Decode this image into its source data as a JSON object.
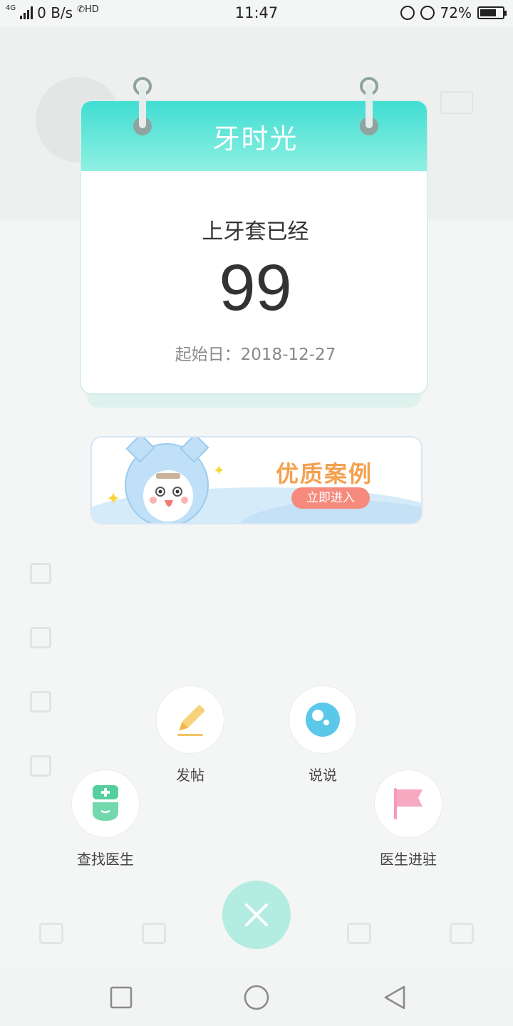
{
  "status_bar": {
    "network_tag": "4G",
    "speed": "0 B/s",
    "call_tag": "HD",
    "time": "11:47",
    "battery": "72%",
    "battery_level": 0.72
  },
  "calendar": {
    "title": "牙时光",
    "label": "上牙套已经",
    "count": "99",
    "start_date": "起始日：2018-12-27"
  },
  "banner": {
    "title": "优质案例",
    "button": "立即进入"
  },
  "actions": {
    "post": {
      "label": "发帖",
      "icon": "pencil-icon"
    },
    "talk": {
      "label": "说说",
      "icon": "bubble-icon"
    },
    "find_doctor": {
      "label": "查找医生",
      "icon": "doctor-icon"
    },
    "doctor_join": {
      "label": "医生进驻",
      "icon": "flag-icon"
    }
  },
  "colors": {
    "accent": "#41ddd2",
    "fab": "#b3ece0",
    "banner_text": "#f3a14f",
    "banner_button": "#f58a7d"
  },
  "system_nav": {
    "recent": "square-icon",
    "home": "circle-icon",
    "back": "triangle-back-icon"
  }
}
